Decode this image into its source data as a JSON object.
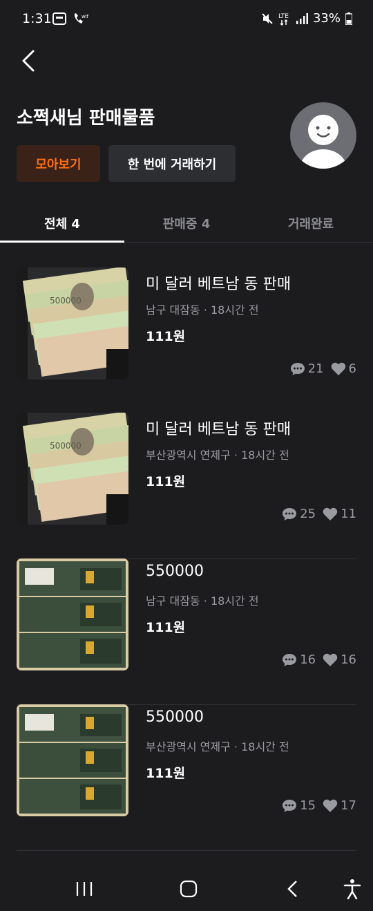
{
  "status_bar": {
    "time": "1:31",
    "battery": "33%"
  },
  "header": {
    "title": "소쩍새님 판매물품"
  },
  "buttons": {
    "view_all": "모아보기",
    "trade_once": "한 번에 거래하기"
  },
  "tabs": [
    {
      "label": "전체 4",
      "active": true
    },
    {
      "label": "판매중 4",
      "active": false
    },
    {
      "label": "거래완료",
      "active": false
    }
  ],
  "items": [
    {
      "title": "미 달러 베트남 동 판매",
      "meta": "남구 대잠동 · 18시간 전",
      "price": "111원",
      "chats": "21",
      "likes": "6",
      "image": "vietnamese-dong-banknotes"
    },
    {
      "title": "미 달러 베트남 동 판매",
      "meta": "부산광역시 연제구 · 18시간 전",
      "price": "111원",
      "chats": "25",
      "likes": "11",
      "image": "vietnamese-dong-banknotes"
    },
    {
      "title": "550000",
      "meta": "남구 대잠동 · 18시간 전",
      "price": "111원",
      "chats": "16",
      "likes": "16",
      "image": "gold-bars-in-cases"
    },
    {
      "title": "550000",
      "meta": "부산광역시 연제구 · 18시간 전",
      "price": "111원",
      "chats": "15",
      "likes": "17",
      "image": "gold-bars-in-cases"
    }
  ],
  "colors": {
    "background": "#1c1c1e",
    "accent": "#ff6f0f",
    "muted": "#9a9ba0"
  }
}
